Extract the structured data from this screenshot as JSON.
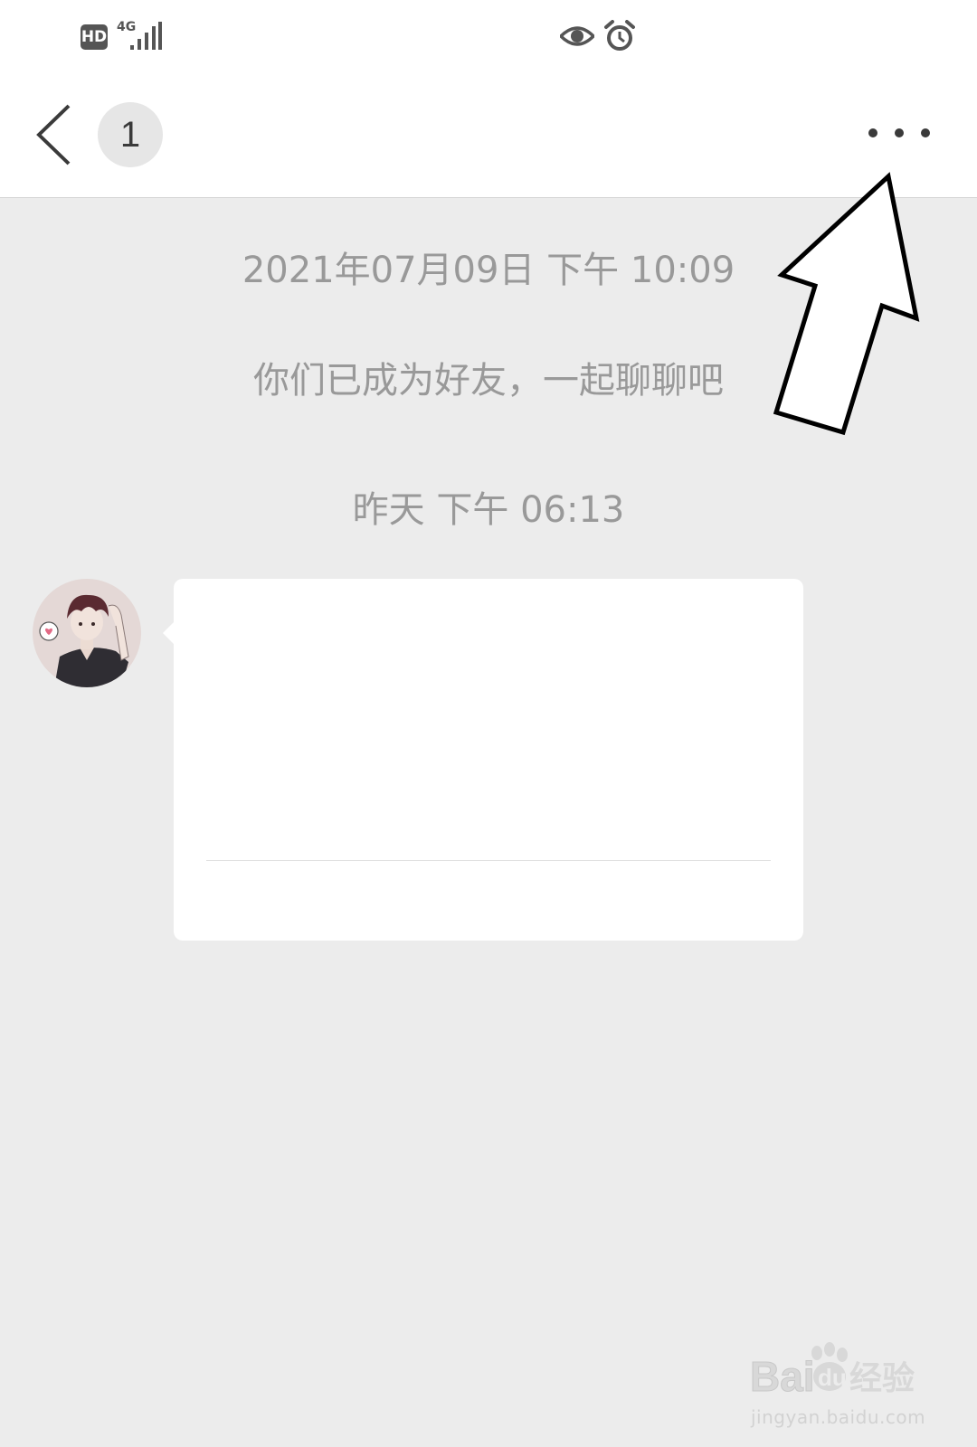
{
  "status_bar": {
    "hd_label": "HD",
    "network_label": "4G",
    "icons": [
      "hd-icon",
      "signal-icon",
      "eye-icon",
      "alarm-icon"
    ]
  },
  "nav": {
    "unread_count": "1",
    "icons": [
      "back-icon",
      "more-icon"
    ]
  },
  "chat": {
    "timestamp_1": "2021年07月09日 下午 10:09",
    "system_message": "你们已成为好友，一起聊聊吧",
    "timestamp_2": "昨天 下午 06:13"
  },
  "watermark": {
    "brand": "Baidu经验",
    "url": "jingyan.baidu.com"
  },
  "colors": {
    "background": "#ececec",
    "header": "#ffffff",
    "meta_text": "#999999"
  }
}
